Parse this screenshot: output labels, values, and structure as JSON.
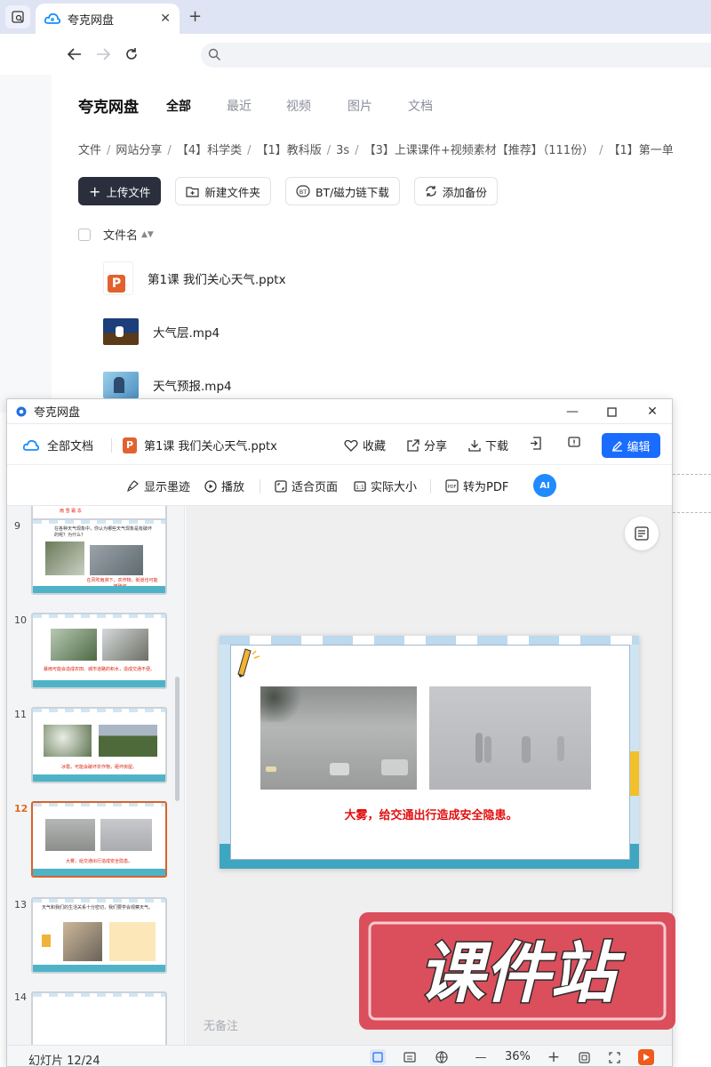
{
  "browser": {
    "tab_title": "夸克网盘",
    "tab_close": "✕",
    "new_tab": "+"
  },
  "page": {
    "brand": "夸克网盘",
    "nav_tabs": [
      "全部",
      "最近",
      "视频",
      "图片",
      "文档"
    ],
    "breadcrumb": [
      "文件",
      "网站分享",
      "【4】科学类",
      "【1】教科版",
      "3s",
      "【3】上课课件+视频素材【推荐】（111份）",
      "【1】第一单"
    ],
    "actions": {
      "upload": "上传文件",
      "new_folder": "新建文件夹",
      "bt": "BT/磁力链下载",
      "backup": "添加备份"
    },
    "file_header": "文件名",
    "files": [
      {
        "name": "第1课 我们关心天气.pptx",
        "type": "pptx"
      },
      {
        "name": "大气层.mp4",
        "type": "video"
      },
      {
        "name": "天气预报.mp4",
        "type": "video"
      }
    ]
  },
  "viewer": {
    "window_title": "夸克网盘",
    "all_docs": "全部文档",
    "doc_name": "第1课 我们关心天气.pptx",
    "favorite": "收藏",
    "share": "分享",
    "download": "下载",
    "edit": "编辑",
    "toolbar2": {
      "ink": "显示墨迹",
      "play": "播放",
      "fit": "适合页面",
      "actual": "实际大小",
      "to_pdf": "转为PDF",
      "ai": "AI"
    },
    "thumbnails": [
      {
        "num": "9",
        "caption": "在风吹雨淋下，农作物，街道也可能被破坏。",
        "text": "在各种天气现象中，你认为哪些天气现象是有破坏的呢？为什么？"
      },
      {
        "num": "10",
        "caption": "暴雨可能会造成农田、城市道路的积水，造成交通不便。",
        "text": ""
      },
      {
        "num": "11",
        "caption": "冰雹，可能会破坏农作物，砸坏房屋。",
        "text": ""
      },
      {
        "num": "12",
        "caption": "大雾，给交通出行造成安全隐患。",
        "text": "",
        "active": true
      },
      {
        "num": "13",
        "caption": "",
        "text": "天气和我们的生活关系十分密切，我们要学会观察天气。"
      },
      {
        "num": "14",
        "caption": "",
        "text": ""
      }
    ],
    "slide_caption": "大雾，给交通出行造成安全隐患。",
    "notes_placeholder": "无备注",
    "slide_counter": "幻灯片 12/24",
    "zoom": "36%"
  },
  "watermark": "课件站",
  "colors": {
    "accent": "#1a6cff",
    "ppt_orange": "#e2622f",
    "caption_red": "#e20f0f",
    "watermark_red": "#d9404f"
  }
}
